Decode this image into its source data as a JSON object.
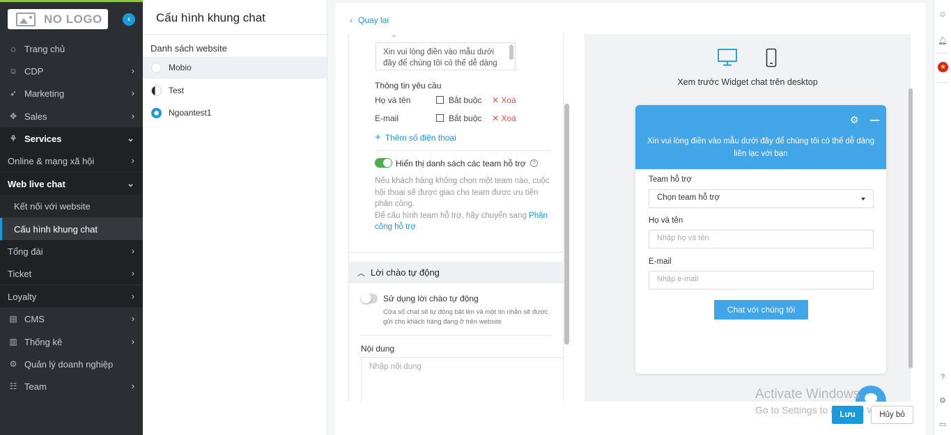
{
  "sidebar": {
    "logo_text": "NO LOGO",
    "items": [
      {
        "label": "Trang chủ",
        "icon": "home-icon"
      },
      {
        "label": "CDP",
        "icon": "user-icon"
      },
      {
        "label": "Marketing",
        "icon": "rocket-icon"
      },
      {
        "label": "Sales",
        "icon": "handshake-icon"
      },
      {
        "label": "Services",
        "icon": "services-icon"
      },
      {
        "label": "Online & mạng xã hội"
      },
      {
        "label": "Web live chat"
      },
      {
        "label": "Kết nối với website"
      },
      {
        "label": "Cấu hình khung chat"
      },
      {
        "label": "Tổng đài"
      },
      {
        "label": "Ticket"
      },
      {
        "label": "Loyalty"
      },
      {
        "label": "CMS",
        "icon": "cms-icon"
      },
      {
        "label": "Thống kê",
        "icon": "chart-icon"
      },
      {
        "label": "Quản lý doanh nghiệp",
        "icon": "gear-icon"
      },
      {
        "label": "Team",
        "icon": "team-icon"
      }
    ]
  },
  "sites_panel": {
    "title": "Cấu hình khung chat",
    "list_title": "Danh sách website",
    "sites": [
      "Mobio",
      "Test",
      "Ngoantest1"
    ]
  },
  "main": {
    "back_label": "Quay lại",
    "form": {
      "textarea_value": "Xin vui lòng điền vào mẫu dưới đây để chúng tôi có thể dễ dàng",
      "request_info_label": "Thông tin yêu cầu",
      "fields": [
        {
          "name": "Họ và tên",
          "required_label": "Bắt buộc",
          "delete_label": "Xoá"
        },
        {
          "name": "E-mail",
          "required_label": "Bắt buộc",
          "delete_label": "Xoá"
        }
      ],
      "add_phone_label": "Thêm số điện thoại",
      "show_teams_label": "Hiển thị danh sách các team hỗ trợ",
      "show_teams_enabled": true,
      "teams_info": "Nếu khách hàng không chọn một team nào, cuộc hội thoại sẽ được giao cho team được ưu tiên phân công.",
      "teams_info_2": "Để cấu hình team hỗ trợ, hãy chuyển sang",
      "teams_info_link": "Phân công hỗ trợ",
      "greeting_section": "Lời chào tự động",
      "greeting_toggle_label": "Sử dụng lời chào tự động",
      "greeting_enabled": false,
      "greeting_desc": "Cửa sổ chat sẽ tự động bật lên và một tin nhắn sẽ được gửi cho khách hàng đang ở trên website",
      "content_label": "Nội dung",
      "content_placeholder": "Nhập nội dung"
    },
    "preview": {
      "title": "Xem trước Widget chat trên desktop",
      "widget_message": "Xin vui lòng điền vào mẫu dưới đây để chúng tôi có thể dễ dàng liên lạc với bạn",
      "team_label": "Team hỗ trợ",
      "team_select": "Chọn team hỗ trợ",
      "name_label": "Họ và tên",
      "name_placeholder": "Nhập họ và tên",
      "email_label": "E-mail",
      "email_placeholder": "Nhập e-mail",
      "submit_label": "Chat với chúng tôi"
    },
    "watermark_1": "Activate Windows",
    "watermark_2": "Go to Settings to activate Windows.",
    "save_label": "Lưu",
    "cancel_label": "Hủy bỏ"
  },
  "colors": {
    "accent": "#1a9ad8",
    "widget_header": "#42a5e8",
    "sidebar_bg": "#2b2f33",
    "toggle_on": "#4caf50",
    "delete": "#e8544e"
  }
}
